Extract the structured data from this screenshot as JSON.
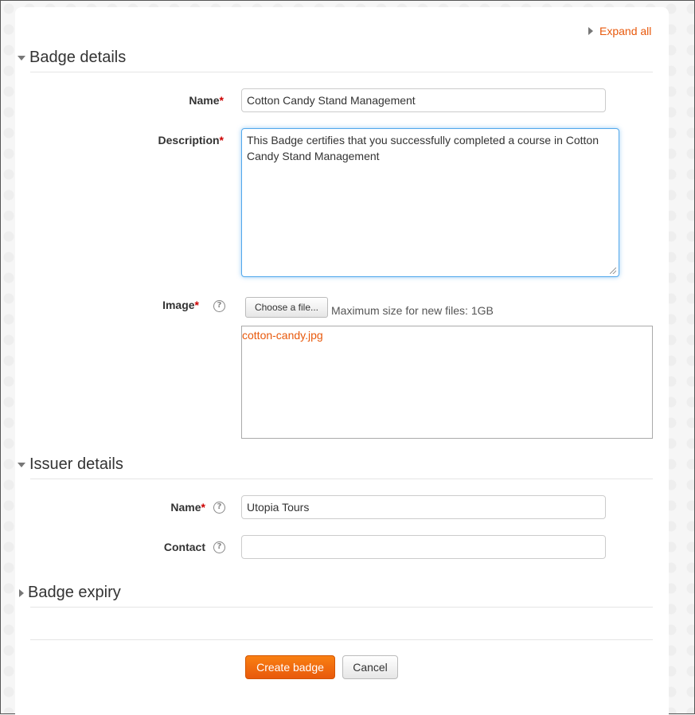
{
  "expand_all_label": "Expand all",
  "sections": {
    "badge_details": "Badge details",
    "issuer_details": "Issuer details",
    "badge_expiry": "Badge expiry"
  },
  "badge": {
    "name_label": "Name",
    "name_value": "Cotton Candy Stand Management",
    "description_label": "Description",
    "description_value": "This Badge certifies that you successfully completed a course in Cotton Candy Stand Management",
    "image_label": "Image",
    "choose_file_label": "Choose a file...",
    "max_size_text": "Maximum size for new files: 1GB",
    "file_name": "cotton-candy.jpg"
  },
  "issuer": {
    "name_label": "Name",
    "name_value": "Utopia Tours",
    "contact_label": "Contact",
    "contact_value": ""
  },
  "required_marker": "*",
  "help_glyph": "?",
  "buttons": {
    "create": "Create badge",
    "cancel": "Cancel"
  },
  "colors": {
    "accent": "#e8590c",
    "required": "#cc0000",
    "primary_button": "#f98012"
  }
}
